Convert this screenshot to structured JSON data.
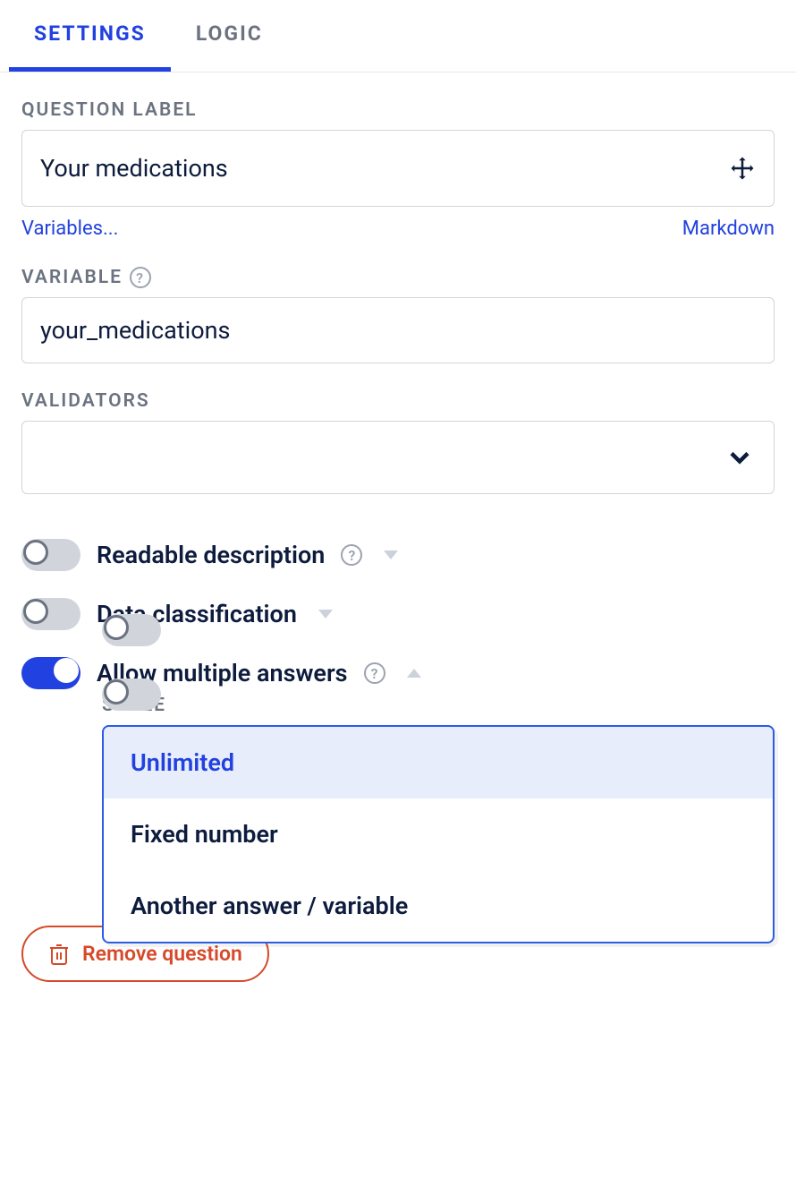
{
  "tabs": {
    "settings": "SETTINGS",
    "logic": "LOGIC"
  },
  "question_label": {
    "header": "QUESTION LABEL",
    "value": "Your medications",
    "variables_link": "Variables...",
    "markdown_link": "Markdown"
  },
  "variable": {
    "header": "VARIABLE",
    "value": "your_medications"
  },
  "validators": {
    "header": "VALIDATORS",
    "value": ""
  },
  "toggles": {
    "readable_description": "Readable description",
    "data_classification": "Data classification",
    "allow_multiple": "Allow multiple answers"
  },
  "style": {
    "header": "STYLE",
    "selected": "Unlimited",
    "options": [
      "Unlimited",
      "Fixed number",
      "Another answer / variable"
    ]
  },
  "remove_button": "Remove question"
}
